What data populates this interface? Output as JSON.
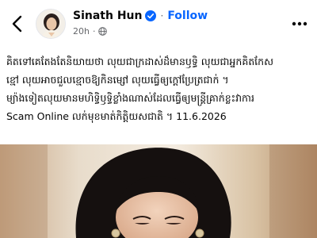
{
  "post": {
    "author_name": "Sinath Hun",
    "follow_label": "Follow",
    "time_ago": "20h",
    "meta_separator": "·",
    "text_lines": [
      "គិតទៅគេតែងតែនិយាយថា លុយជាក្រដាស់ដ៏មានឫទ្ធិ លុយជាអ្នកគិតកែស",
      "ខ្មៅ លុយអាចជួលខ្មោចឱ្យកិនម្សៅ លុយធ្វើឲ្យក្ដៅប្រែត្រជាក់ ។",
      "ម្យ៉ាងទៀតលុយមានមហិទ្ធិឫទ្ធិខ្លាំងណាស់ដែលធ្វើឲ្យមន្ត្រីគ្រាក់ខ្លះវា​ការ",
      "Scam Online លក់មុខមាត់កិត្តិយសជាតិ ។ 11.6.2026"
    ]
  },
  "icons": {
    "back": "back-arrow-icon",
    "verified": "verified-badge-icon",
    "audience": "globe-icon",
    "more": "more-options-icon"
  },
  "colors": {
    "follow": "#0866ff",
    "verified": "#0866ff",
    "meta": "#65676b",
    "text": "#050505"
  }
}
